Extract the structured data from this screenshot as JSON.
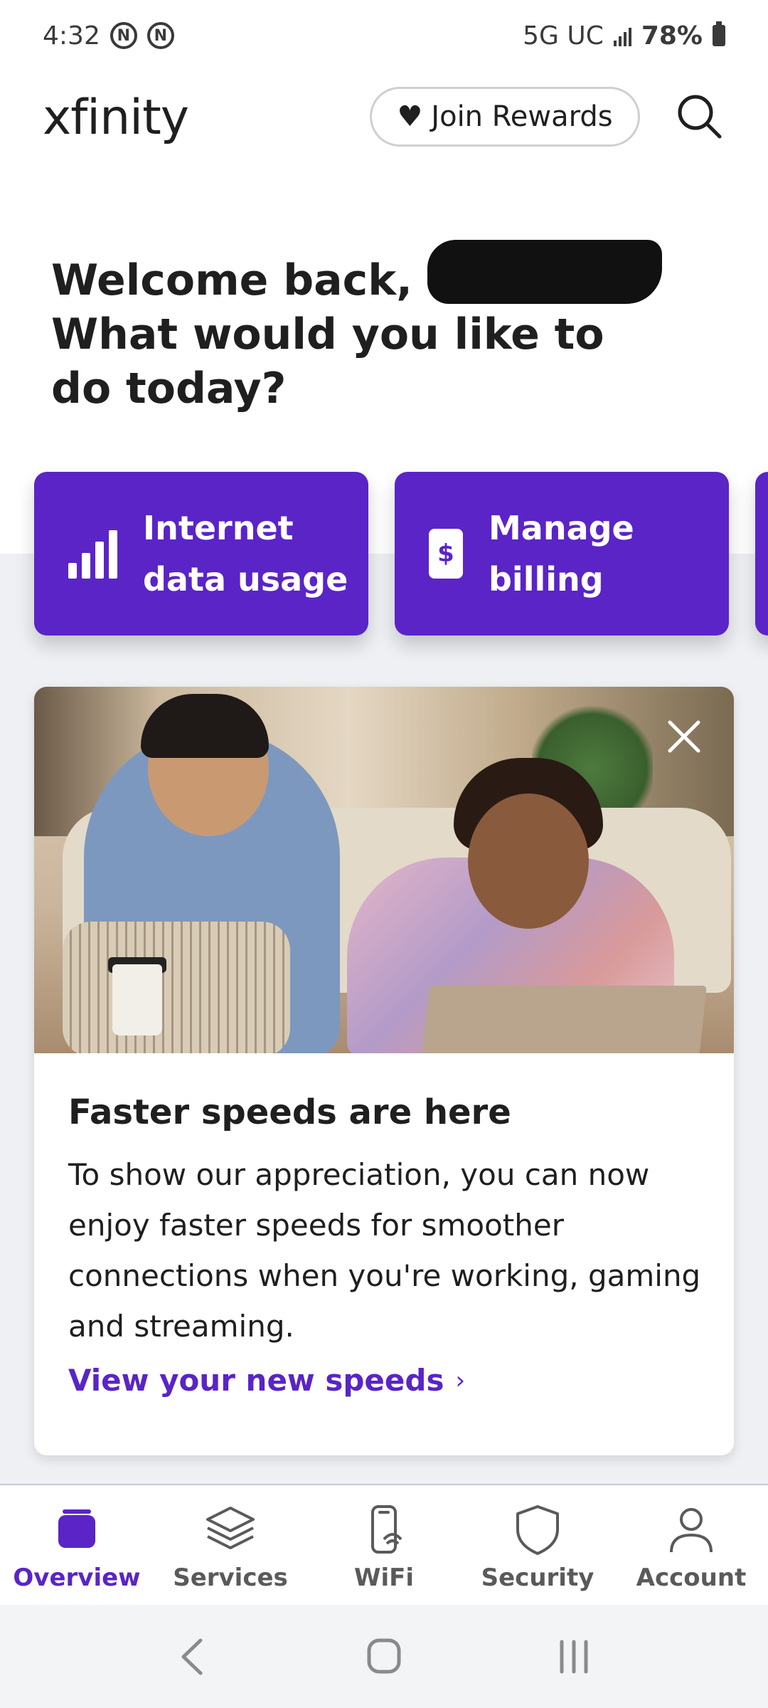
{
  "status_bar": {
    "time": "4:32",
    "network": "5G UC",
    "battery": "78%",
    "notification_icons": [
      "n-icon",
      "n-icon"
    ]
  },
  "header": {
    "logo": "xfinity",
    "rewards_label": "Join Rewards",
    "icons": [
      "heart-icon",
      "search-icon"
    ]
  },
  "welcome": {
    "line1": "Welcome back,",
    "line2": "What would you like to do today?"
  },
  "quick_actions": [
    {
      "line1": "Internet",
      "line2": "data usage",
      "icon": "signal-bars-icon"
    },
    {
      "line1": "Manage",
      "line2": "billing",
      "icon": "bill-icon",
      "icon_glyph": "$"
    }
  ],
  "promo": {
    "title": "Faster speeds are here",
    "body": "To show our appreciation, you can now enjoy faster speeds for smoother connections when you're working, gaming and streaming.",
    "link_label": "View your new speeds",
    "link_chevron": "›"
  },
  "bottom_nav": [
    {
      "label": "Overview",
      "icon": "overview-icon",
      "active": true
    },
    {
      "label": "Services",
      "icon": "layers-icon",
      "active": false
    },
    {
      "label": "WiFi",
      "icon": "wifi-device-icon",
      "active": false
    },
    {
      "label": "Security",
      "icon": "shield-icon",
      "active": false
    },
    {
      "label": "Account",
      "icon": "person-icon",
      "active": false
    }
  ],
  "system_nav": [
    "back-icon",
    "home-icon",
    "recents-icon"
  ],
  "colors": {
    "brand_purple": "#5a24c7",
    "text_dark": "#1f1f1f",
    "background_grey": "#eef0f3"
  }
}
